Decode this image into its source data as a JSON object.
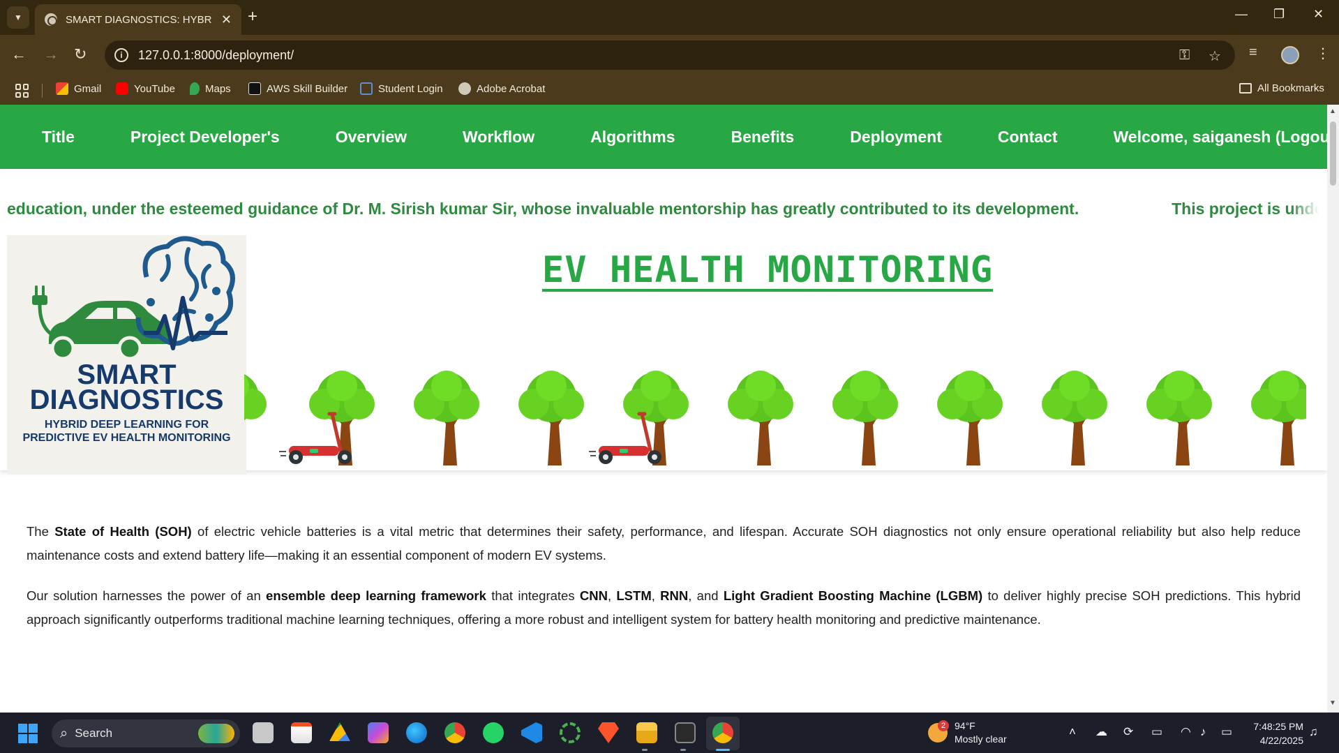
{
  "browser": {
    "tab_title": "SMART DIAGNOSTICS: HYBRID",
    "tab_close": "✕",
    "new_tab": "+",
    "url": "127.0.0.1:8000/deployment/",
    "bookmarks": [
      "Gmail",
      "YouTube",
      "Maps",
      "AWS Skill Builder",
      "Student Login",
      "Adobe Acrobat"
    ],
    "all_bookmarks": "All Bookmarks"
  },
  "nav": {
    "items": [
      "Title",
      "Project Developer's",
      "Overview",
      "Workflow",
      "Algorithms",
      "Benefits",
      "Deployment",
      "Contact",
      "Welcome, saiganesh (Logout)"
    ]
  },
  "hero": {
    "marquee": "education, under the esteemed guidance of Dr. M. Sirish kumar Sir, whose invaluable mentorship has greatly contributed to its development.",
    "marquee_next": "This project is undertaken with t",
    "title": "EV HEALTH MONITORING",
    "logo_line1": "SMART",
    "logo_line2": "DIAGNOSTICS",
    "logo_line3": "HYBRID DEEP LEARNING FOR",
    "logo_line4": "PREDICTIVE EV HEALTH MONITORING"
  },
  "content": {
    "p1": {
      "a": "The ",
      "b1": "State of Health (SOH)",
      "c": " of electric vehicle batteries is a vital metric that determines their safety, performance, and lifespan. Accurate SOH diagnostics not only ensure operational reliability but also help reduce maintenance costs and extend battery life—making it an essential component of modern EV systems."
    },
    "p2": {
      "a": "Our solution harnesses the power of an ",
      "b1": "ensemble deep learning framework",
      "c": " that integrates ",
      "b2": "CNN",
      "d": ", ",
      "b3": "LSTM",
      "e": ", ",
      "b4": "RNN",
      "f": ", and ",
      "b5": "Light Gradient Boosting Machine (LGBM)",
      "g": " to deliver highly precise SOH predictions. This hybrid approach significantly outperforms traditional machine learning techniques, offering a more robust and intelligent system for battery health monitoring and predictive maintenance."
    }
  },
  "taskbar": {
    "search": "Search",
    "weather_temp": "94°F",
    "weather_desc": "Mostly clear",
    "weather_badge": "2",
    "time": "7:48:25 PM",
    "date": "4/22/2025"
  },
  "colors": {
    "accent_green": "#28a745",
    "logo_navy": "#153a6b",
    "chrome_brown": "#4b3b1c"
  }
}
